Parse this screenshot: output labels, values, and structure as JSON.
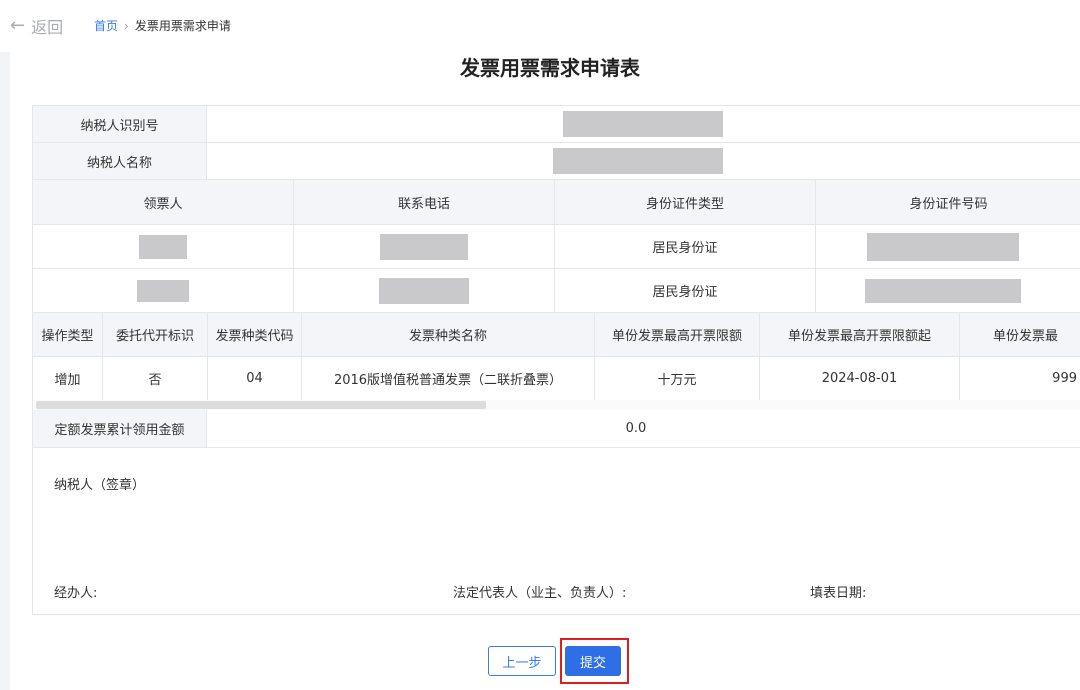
{
  "nav": {
    "back_label": "返回",
    "breadcrumb_home": "首页",
    "breadcrumb_current": "发票用票需求申请"
  },
  "form": {
    "title": "发票用票需求申请表",
    "taxpayer_id_label": "纳税人识别号",
    "taxpayer_name_label": "纳税人名称",
    "recipients_headers": [
      "领票人",
      "联系电话",
      "身份证件类型",
      "身份证件号码"
    ],
    "recipients": [
      {
        "id_type": "居民身份证"
      },
      {
        "id_type": "居民身份证"
      }
    ],
    "invoice_headers": [
      "操作类型",
      "委托代开标识",
      "发票种类代码",
      "发票种类名称",
      "单份发票最高开票限额",
      "单份发票最高开票限额起",
      "单份发票最"
    ],
    "invoice_row": [
      "增加",
      "否",
      "04",
      "2016版增值税普通发票（二联折叠票）",
      "十万元",
      "2024-08-01",
      "999"
    ],
    "quota_label": "定额发票累计领用金额",
    "quota_value": "0.0",
    "signature_label": "纳税人（签章）",
    "handler_label": "经办人:",
    "legal_rep_label": "法定代表人（业主、负责人）:",
    "fill_date_label": "填表日期:"
  },
  "actions": {
    "prev_label": "上一步",
    "submit_label": "提交"
  },
  "colors": {
    "accent": "#2f6fe6",
    "highlight": "#e21d1d",
    "mask": "#c9c9cb"
  }
}
